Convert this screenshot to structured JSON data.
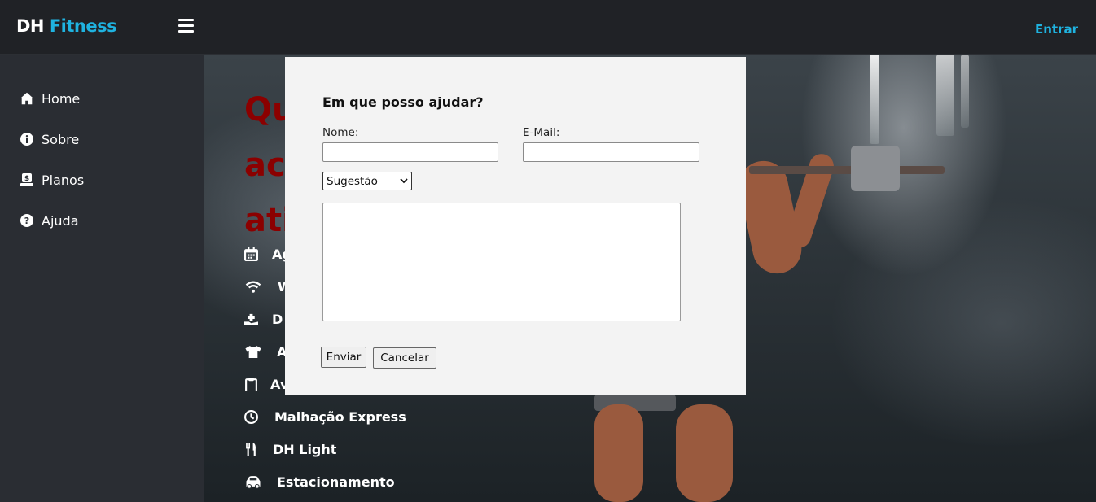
{
  "topbar": {
    "brand_part1": "DH",
    "brand_part2": "Fitness",
    "menu_icon": "hamburger-icon",
    "login_label": "Entrar"
  },
  "sidebar": {
    "items": [
      {
        "label": "Home",
        "icon": "home-icon"
      },
      {
        "label": "Sobre",
        "icon": "info-icon"
      },
      {
        "label": "Planos",
        "icon": "money-icon"
      },
      {
        "label": "Ajuda",
        "icon": "question-icon"
      }
    ]
  },
  "hero": {
    "title_lines": [
      "Qu",
      "ac",
      "ati"
    ],
    "features": [
      {
        "label": "Ag",
        "icon": "calendar-icon"
      },
      {
        "label": "W",
        "icon": "wifi-icon"
      },
      {
        "label": "D",
        "icon": "hand-plus-icon"
      },
      {
        "label": "A",
        "icon": "tshirt-icon"
      },
      {
        "label": "Av",
        "icon": "clipboard-icon"
      },
      {
        "label": "Malhação Express",
        "icon": "clock-icon"
      },
      {
        "label": "DH Light",
        "icon": "utensils-icon"
      },
      {
        "label": "Estacionamento",
        "icon": "car-icon"
      }
    ]
  },
  "modal": {
    "title": "Em que posso ajudar?",
    "name_label": "Nome:",
    "name_value": "",
    "email_label": "E-Mail:",
    "email_value": "",
    "select_value": "Sugestão",
    "message_value": "",
    "submit_label": "Enviar",
    "cancel_label": "Cancelar"
  },
  "colors": {
    "accent": "#1fb3e0",
    "hero_title": "#8b0000",
    "topbar": "#202226",
    "sidebar": "#2a2d33",
    "modal_bg": "#f3f3f3"
  }
}
